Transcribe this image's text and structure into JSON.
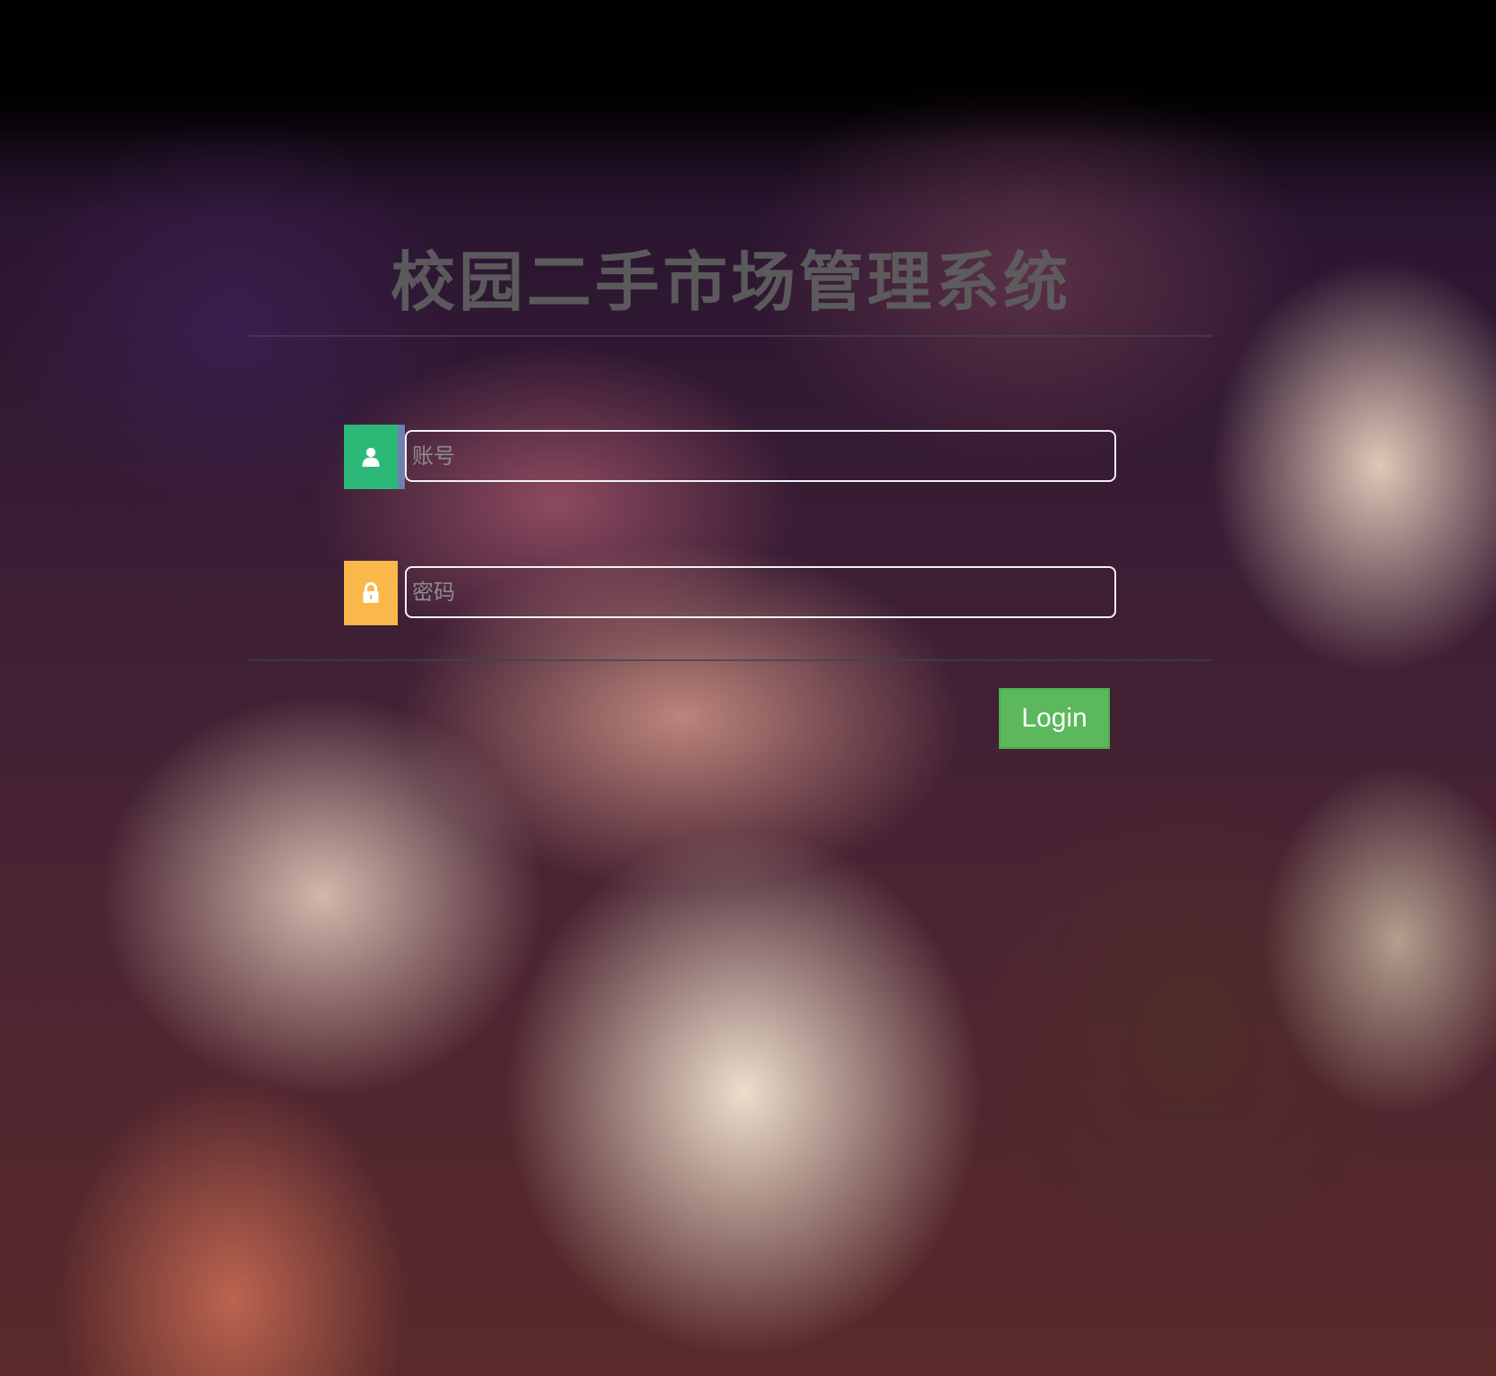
{
  "app": {
    "title": "校园二手市场管理系统"
  },
  "login_form": {
    "username": {
      "icon": "user-icon",
      "value": "",
      "placeholder": "账号"
    },
    "password": {
      "icon": "lock-icon",
      "value": "",
      "placeholder": "密码"
    },
    "submit_label": "Login"
  },
  "colors": {
    "user_icon_bg": "#2cb977",
    "lock_icon_bg": "#fbb84a",
    "login_button": "#5cb85c",
    "title_text": "#5f5f5f"
  }
}
